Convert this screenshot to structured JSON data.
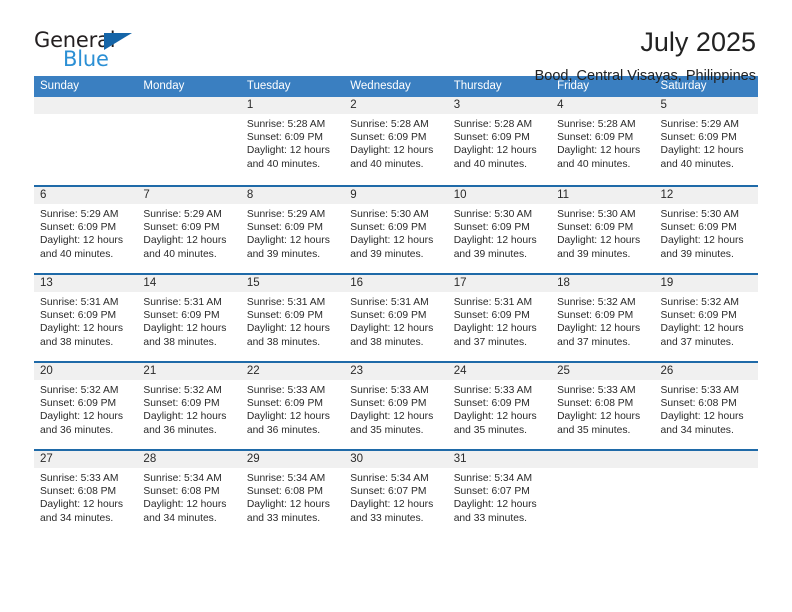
{
  "brand": {
    "word_one": "General",
    "word_two": "Blue",
    "triangle_icon": "triangle-icon",
    "colors": {
      "dark": "#231f20",
      "blue": "#2b8fd4",
      "triangle": "#1565a8"
    }
  },
  "header": {
    "title": "July 2025",
    "subtitle": "Bood, Central Visayas, Philippines"
  },
  "theme": {
    "header_bg": "#3a7fc1",
    "row_divider": "#1f6aa8",
    "day_number_bg": "#f0f0f0"
  },
  "weekdays": [
    "Sunday",
    "Monday",
    "Tuesday",
    "Wednesday",
    "Thursday",
    "Friday",
    "Saturday"
  ],
  "weeks": [
    [
      {
        "day": "",
        "empty": true
      },
      {
        "day": "",
        "empty": true
      },
      {
        "day": "1",
        "sunrise": "Sunrise: 5:28 AM",
        "sunset": "Sunset: 6:09 PM",
        "daylight": "Daylight: 12 hours and 40 minutes."
      },
      {
        "day": "2",
        "sunrise": "Sunrise: 5:28 AM",
        "sunset": "Sunset: 6:09 PM",
        "daylight": "Daylight: 12 hours and 40 minutes."
      },
      {
        "day": "3",
        "sunrise": "Sunrise: 5:28 AM",
        "sunset": "Sunset: 6:09 PM",
        "daylight": "Daylight: 12 hours and 40 minutes."
      },
      {
        "day": "4",
        "sunrise": "Sunrise: 5:28 AM",
        "sunset": "Sunset: 6:09 PM",
        "daylight": "Daylight: 12 hours and 40 minutes."
      },
      {
        "day": "5",
        "sunrise": "Sunrise: 5:29 AM",
        "sunset": "Sunset: 6:09 PM",
        "daylight": "Daylight: 12 hours and 40 minutes."
      }
    ],
    [
      {
        "day": "6",
        "sunrise": "Sunrise: 5:29 AM",
        "sunset": "Sunset: 6:09 PM",
        "daylight": "Daylight: 12 hours and 40 minutes."
      },
      {
        "day": "7",
        "sunrise": "Sunrise: 5:29 AM",
        "sunset": "Sunset: 6:09 PM",
        "daylight": "Daylight: 12 hours and 40 minutes."
      },
      {
        "day": "8",
        "sunrise": "Sunrise: 5:29 AM",
        "sunset": "Sunset: 6:09 PM",
        "daylight": "Daylight: 12 hours and 39 minutes."
      },
      {
        "day": "9",
        "sunrise": "Sunrise: 5:30 AM",
        "sunset": "Sunset: 6:09 PM",
        "daylight": "Daylight: 12 hours and 39 minutes."
      },
      {
        "day": "10",
        "sunrise": "Sunrise: 5:30 AM",
        "sunset": "Sunset: 6:09 PM",
        "daylight": "Daylight: 12 hours and 39 minutes."
      },
      {
        "day": "11",
        "sunrise": "Sunrise: 5:30 AM",
        "sunset": "Sunset: 6:09 PM",
        "daylight": "Daylight: 12 hours and 39 minutes."
      },
      {
        "day": "12",
        "sunrise": "Sunrise: 5:30 AM",
        "sunset": "Sunset: 6:09 PM",
        "daylight": "Daylight: 12 hours and 39 minutes."
      }
    ],
    [
      {
        "day": "13",
        "sunrise": "Sunrise: 5:31 AM",
        "sunset": "Sunset: 6:09 PM",
        "daylight": "Daylight: 12 hours and 38 minutes."
      },
      {
        "day": "14",
        "sunrise": "Sunrise: 5:31 AM",
        "sunset": "Sunset: 6:09 PM",
        "daylight": "Daylight: 12 hours and 38 minutes."
      },
      {
        "day": "15",
        "sunrise": "Sunrise: 5:31 AM",
        "sunset": "Sunset: 6:09 PM",
        "daylight": "Daylight: 12 hours and 38 minutes."
      },
      {
        "day": "16",
        "sunrise": "Sunrise: 5:31 AM",
        "sunset": "Sunset: 6:09 PM",
        "daylight": "Daylight: 12 hours and 38 minutes."
      },
      {
        "day": "17",
        "sunrise": "Sunrise: 5:31 AM",
        "sunset": "Sunset: 6:09 PM",
        "daylight": "Daylight: 12 hours and 37 minutes."
      },
      {
        "day": "18",
        "sunrise": "Sunrise: 5:32 AM",
        "sunset": "Sunset: 6:09 PM",
        "daylight": "Daylight: 12 hours and 37 minutes."
      },
      {
        "day": "19",
        "sunrise": "Sunrise: 5:32 AM",
        "sunset": "Sunset: 6:09 PM",
        "daylight": "Daylight: 12 hours and 37 minutes."
      }
    ],
    [
      {
        "day": "20",
        "sunrise": "Sunrise: 5:32 AM",
        "sunset": "Sunset: 6:09 PM",
        "daylight": "Daylight: 12 hours and 36 minutes."
      },
      {
        "day": "21",
        "sunrise": "Sunrise: 5:32 AM",
        "sunset": "Sunset: 6:09 PM",
        "daylight": "Daylight: 12 hours and 36 minutes."
      },
      {
        "day": "22",
        "sunrise": "Sunrise: 5:33 AM",
        "sunset": "Sunset: 6:09 PM",
        "daylight": "Daylight: 12 hours and 36 minutes."
      },
      {
        "day": "23",
        "sunrise": "Sunrise: 5:33 AM",
        "sunset": "Sunset: 6:09 PM",
        "daylight": "Daylight: 12 hours and 35 minutes."
      },
      {
        "day": "24",
        "sunrise": "Sunrise: 5:33 AM",
        "sunset": "Sunset: 6:09 PM",
        "daylight": "Daylight: 12 hours and 35 minutes."
      },
      {
        "day": "25",
        "sunrise": "Sunrise: 5:33 AM",
        "sunset": "Sunset: 6:08 PM",
        "daylight": "Daylight: 12 hours and 35 minutes."
      },
      {
        "day": "26",
        "sunrise": "Sunrise: 5:33 AM",
        "sunset": "Sunset: 6:08 PM",
        "daylight": "Daylight: 12 hours and 34 minutes."
      }
    ],
    [
      {
        "day": "27",
        "sunrise": "Sunrise: 5:33 AM",
        "sunset": "Sunset: 6:08 PM",
        "daylight": "Daylight: 12 hours and 34 minutes."
      },
      {
        "day": "28",
        "sunrise": "Sunrise: 5:34 AM",
        "sunset": "Sunset: 6:08 PM",
        "daylight": "Daylight: 12 hours and 34 minutes."
      },
      {
        "day": "29",
        "sunrise": "Sunrise: 5:34 AM",
        "sunset": "Sunset: 6:08 PM",
        "daylight": "Daylight: 12 hours and 33 minutes."
      },
      {
        "day": "30",
        "sunrise": "Sunrise: 5:34 AM",
        "sunset": "Sunset: 6:07 PM",
        "daylight": "Daylight: 12 hours and 33 minutes."
      },
      {
        "day": "31",
        "sunrise": "Sunrise: 5:34 AM",
        "sunset": "Sunset: 6:07 PM",
        "daylight": "Daylight: 12 hours and 33 minutes."
      },
      {
        "day": "",
        "empty": true
      },
      {
        "day": "",
        "empty": true
      }
    ]
  ]
}
